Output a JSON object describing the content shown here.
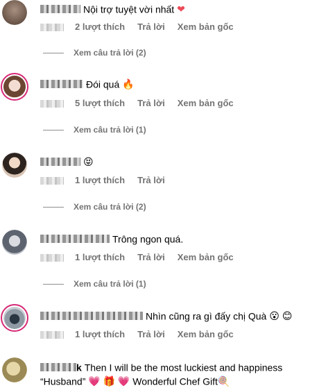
{
  "comments": [
    {
      "text": "Nội trợ tuyệt vời nhất",
      "emoji": "❤",
      "likes": "2 lượt thích",
      "reply": "Trả lời",
      "see_original": "Xem bản gốc",
      "view_replies": "Xem câu trả lời (2)"
    },
    {
      "text": "Đói quá",
      "emoji": "🔥",
      "likes": "5 lượt thích",
      "reply": "Trả lời",
      "see_original": "Xem bản gốc",
      "view_replies": "Xem câu trả lời (1)"
    },
    {
      "text": "",
      "emoji": "😝",
      "likes": "1 lượt thích",
      "reply": "Trả lời",
      "view_replies": "Xem câu trả lời (2)"
    },
    {
      "text": "Trông ngon quá.",
      "likes": "1 lượt thích",
      "reply": "Trả lời",
      "see_original": "Xem bản gốc",
      "view_replies": "Xem câu trả lời (1)"
    },
    {
      "text": "Nhìn cũng ra gì đấy chị Quà",
      "emoji": "😮 😊",
      "likes": "1 lượt thích",
      "reply": "Trả lời",
      "see_original": "Xem bản gốc"
    },
    {
      "user_suffix": "k",
      "line1": "Then I will be the most luckiest and happiness",
      "line2_a": "“Husband”",
      "line2_emoji": "💗 🎁 💗",
      "line2_b": "Wonderful Chef Gift",
      "line2_emoji_end": "🍭"
    }
  ],
  "colors": {
    "secondary_text": "#737373",
    "story_ring": "#d62976",
    "heart": "#ed4956"
  }
}
